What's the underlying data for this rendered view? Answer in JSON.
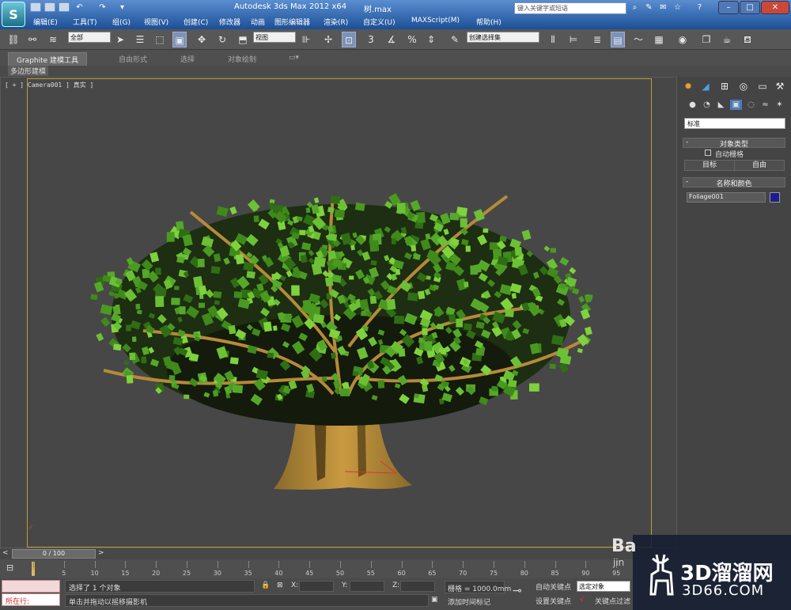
{
  "window": {
    "title": "Autodesk 3ds Max  2012 x64",
    "file": "树.max",
    "search_placeholder": "键入关键字或短语",
    "logo": "S"
  },
  "menu": [
    "编辑(E)",
    "工具(T)",
    "组(G)",
    "视图(V)",
    "创建(C)",
    "修改器",
    "动画",
    "图形编辑器",
    "渲染(R)",
    "自定义(U)",
    "MAXScript(M)",
    "帮助(H)"
  ],
  "toolbar": {
    "selection_filter": "全部",
    "ref_coord": "视图",
    "snap_3": "3",
    "named_selection": "创建选择集"
  },
  "ribbon": {
    "tabs": [
      "Graphite 建模工具",
      "自由形式",
      "选择",
      "对象绘制"
    ],
    "sub_tab": "多边形建模"
  },
  "viewport": {
    "label": "[ + ] Camera001 ] 真实 ]"
  },
  "command_panel": {
    "dropdown": "标准",
    "object_type_title": "对象类型",
    "autogrid_label": "自动栅格",
    "btn_target": "目标",
    "btn_free": "自由",
    "name_color_title": "名称和颜色",
    "object_name": "Foliage001",
    "object_color": "#1b1d8f",
    "collapse": "-"
  },
  "timeline": {
    "slider": "0 / 100",
    "ticks": [
      "0",
      "5",
      "10",
      "15",
      "20",
      "25",
      "30",
      "35",
      "40",
      "45",
      "50",
      "55",
      "60",
      "65",
      "70",
      "75",
      "80",
      "85",
      "90",
      "95"
    ]
  },
  "status": {
    "listener": "所在行:",
    "selected": "选择了 1 个对象",
    "prompt": "单击并拖动以摇移摄影机",
    "x_label": "X:",
    "y_label": "Y:",
    "z_label": "Z:",
    "grid": "栅格 = 1000.0mm",
    "add_tag": "添加时间标记",
    "auto_key": "自动关键点",
    "set_key": "设置关键点",
    "selected_obj": "选定对象",
    "key_filters": "关键点过滤"
  },
  "watermark": {
    "brand_cn": "3D溜溜网",
    "brand_url": "3D66.COM",
    "partial": "Ba",
    "partial2": "jin"
  }
}
